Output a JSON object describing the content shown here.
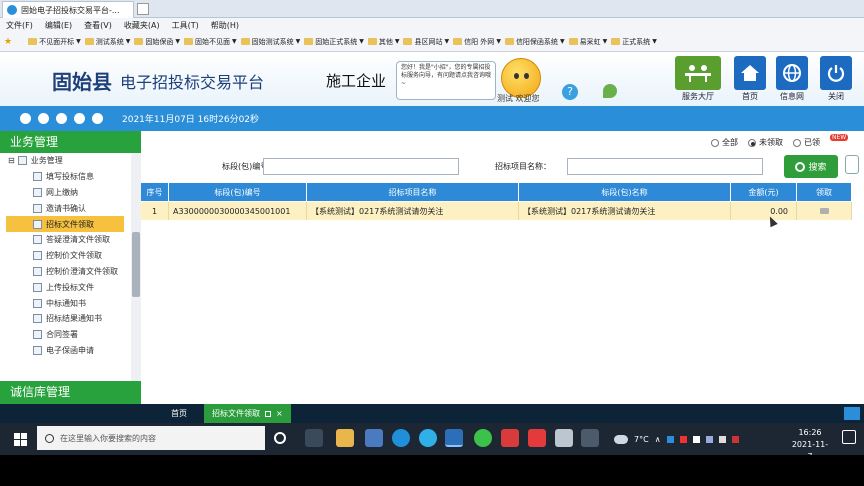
{
  "browser": {
    "tab_title": "固始电子招投标交易平台-...",
    "menu": [
      "文件(F)",
      "编辑(E)",
      "查看(V)",
      "收藏夹(A)",
      "工具(T)",
      "帮助(H)"
    ],
    "favorites": [
      "不见面开标",
      "测试系统",
      "固始保函",
      "固始不见面",
      "固始测试系统",
      "固始正式系统",
      "其他",
      "县区网站",
      "信阳 外网",
      "信阳保函系统",
      "易采虹",
      "正式系统"
    ]
  },
  "header": {
    "county": "固始县",
    "platform": "电子招投标交易平台",
    "company": "施工企业",
    "bubble_text": "您好！我是\"小招\"，您的专属招投标服务向导，有问题请点我咨询哦~",
    "welcome_text": "测试 欢迎您",
    "buttons": {
      "service_hall": "服务大厅",
      "home": "首页",
      "info_net": "信息网",
      "close": "关闭"
    }
  },
  "status": {
    "datetime": "2021年11月07日 16时26分02秒"
  },
  "sidebar": {
    "title": "业务管理",
    "root": "业务管理",
    "items": [
      "填写投标信息",
      "网上缴纳",
      "邀请书确认",
      "招标文件领取",
      "答疑澄清文件领取",
      "控制价文件领取",
      "控制价澄清文件领取",
      "上传投标文件",
      "中标通知书",
      "招标结果通知书",
      "合同签署",
      "电子保函申请"
    ],
    "selected_index": 3,
    "bottom_title": "诚信库管理"
  },
  "filters": {
    "radios": [
      "全部",
      "未领取",
      "已领"
    ],
    "selected_radio": 1,
    "new_badge": "NEW",
    "section_label": "标段(包)编号：",
    "section_value": "",
    "project_label": "招标项目名称：",
    "project_value": "",
    "search_label": "搜索"
  },
  "table": {
    "headers": [
      "序号",
      "标段(包)编号",
      "招标项目名称",
      "标段(包)名称",
      "金额(元)",
      "领取"
    ],
    "rows": [
      [
        "1",
        "A3300000030000345001001",
        "【系统测试】0217系统测试请勿关注",
        "【系统测试】0217系统测试请勿关注",
        "0.00",
        ""
      ]
    ]
  },
  "bottom_tabs": {
    "home": "首页",
    "active": "招标文件领取"
  },
  "taskbar": {
    "search_placeholder": "在这里输入你要搜索的内容",
    "weather": "7°C",
    "time": "16:26",
    "date": "2021-11-7"
  }
}
